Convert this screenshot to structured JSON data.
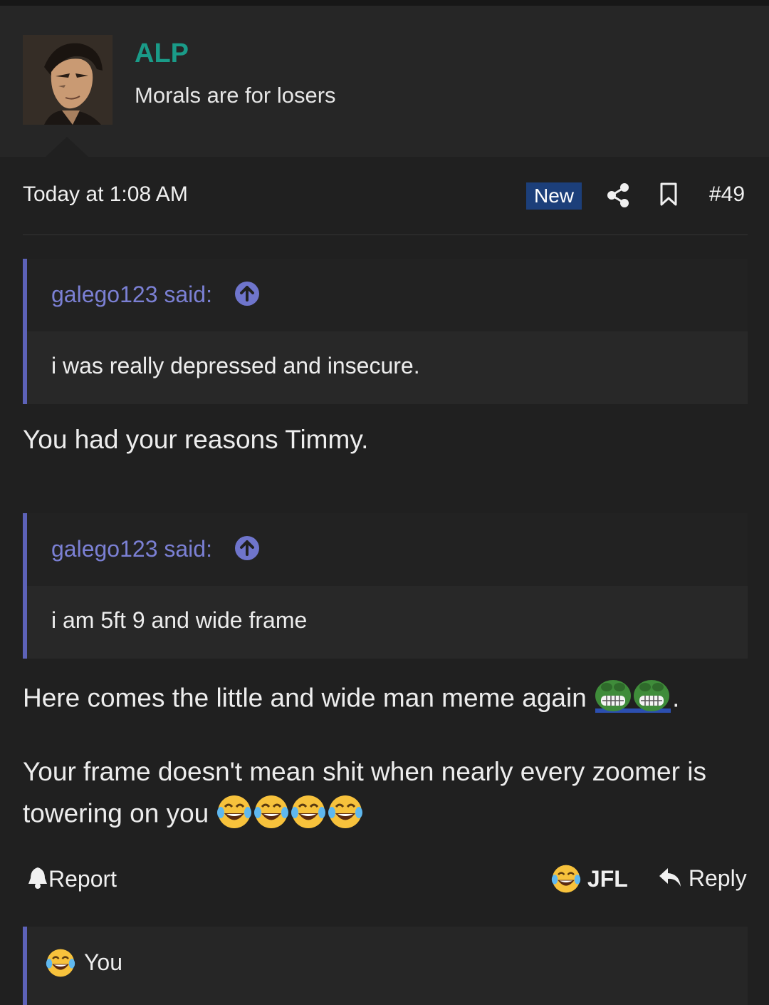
{
  "author": {
    "name": "ALP",
    "title": "Morals are for losers",
    "avatar_icon": "avatar-anime-portrait"
  },
  "meta": {
    "date": "Today at 1:08 AM",
    "badge": "New",
    "post_number": "#49",
    "share_icon": "share-icon",
    "bookmark_icon": "bookmark-icon"
  },
  "quotes": [
    {
      "author": "galego123 said:",
      "text": "i was really depressed and insecure."
    },
    {
      "author": "galego123 said:",
      "text": "i am 5ft 9 and wide frame"
    }
  ],
  "body": {
    "line1": "You had your reasons Timmy.",
    "line2": "Here comes the little and wide man meme again",
    "line2_end": ".",
    "line3a": "Your frame doesn't mean shit when nearly every zoomer is",
    "line3b": "towering on you"
  },
  "actions": {
    "report": "Report",
    "reaction": "JFL",
    "reply": "Reply"
  },
  "reactions": {
    "by": "You"
  },
  "colors": {
    "accent_username": "#1a9b88",
    "quote_border": "#5d62b8",
    "badge_bg": "#1c3f7a"
  }
}
